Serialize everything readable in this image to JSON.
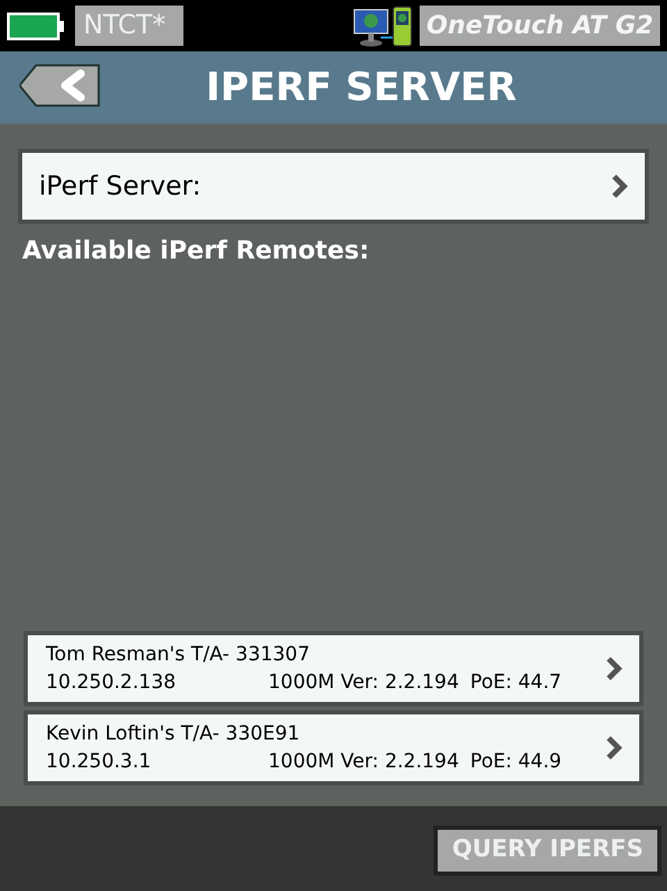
{
  "status_bar": {
    "profile": "NTCT*",
    "device": "OneTouch AT G2"
  },
  "header": {
    "title": "IPERF SERVER"
  },
  "server": {
    "label": "iPerf Server:"
  },
  "remotes_heading": "Available iPerf Remotes:",
  "remotes": [
    {
      "name": "Tom Resman's T/A- 331307",
      "ip": "10.250.2.138",
      "info": "1000M Ver: 2.2.194",
      "poe": "PoE: 44.7"
    },
    {
      "name": "Kevin Loftin's T/A- 330E91",
      "ip": "10.250.3.1",
      "info": "1000M Ver: 2.2.194",
      "poe": "PoE: 44.9"
    }
  ],
  "footer": {
    "button": "QUERY IPERFS"
  }
}
